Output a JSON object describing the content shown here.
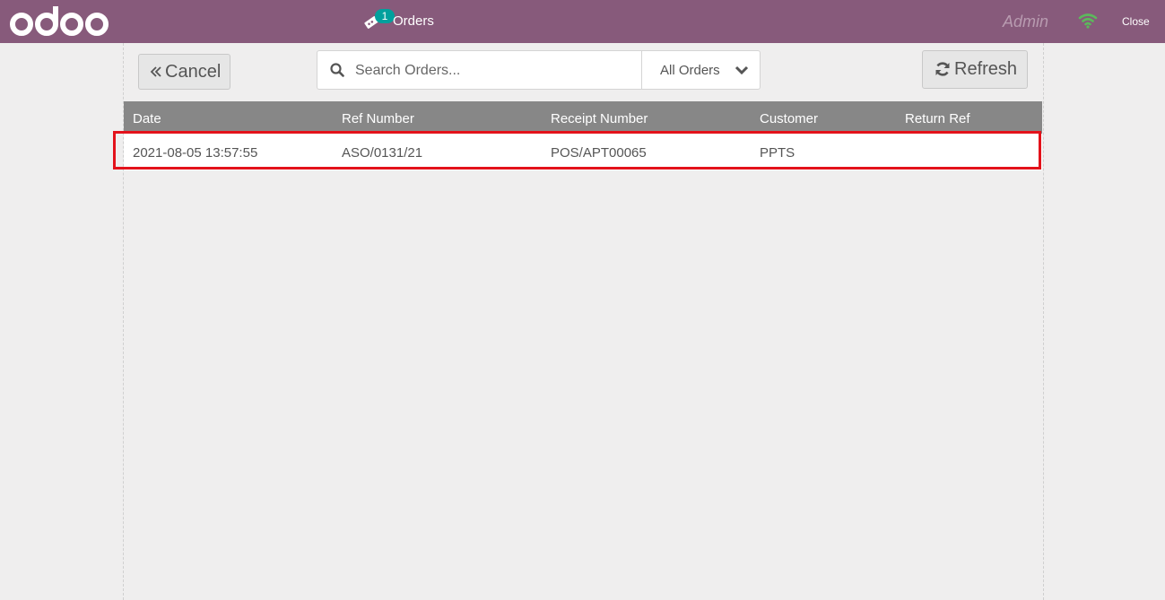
{
  "header": {
    "logo_text": "odoo",
    "orders_tab_label": "Orders",
    "orders_badge_count": "1",
    "user_name": "Admin",
    "close_label": "Close",
    "colors": {
      "topbar": "#875a7b",
      "badge": "#00a09d",
      "wifi": "#5cb85c"
    }
  },
  "toolbar": {
    "cancel_label": "Cancel",
    "refresh_label": "Refresh",
    "search_placeholder": "Search Orders...",
    "filter_selected": "All Orders"
  },
  "table": {
    "headers": [
      "Date",
      "Ref Number",
      "Receipt Number",
      "Customer",
      "Return Ref"
    ],
    "rows": [
      [
        "2021-08-05 13:57:55",
        "ASO/0131/21",
        "POS/APT00065",
        "PPTS",
        ""
      ]
    ],
    "highlight_color": "#e3121b"
  },
  "icons": {
    "logo": "odoo-logo-icon",
    "orders_tab": "ticket-icon",
    "network": "wifi-icon",
    "cancel": "double-chevron-left-icon",
    "refresh": "refresh-icon",
    "search": "search-icon",
    "filter": "chevron-down-icon"
  }
}
